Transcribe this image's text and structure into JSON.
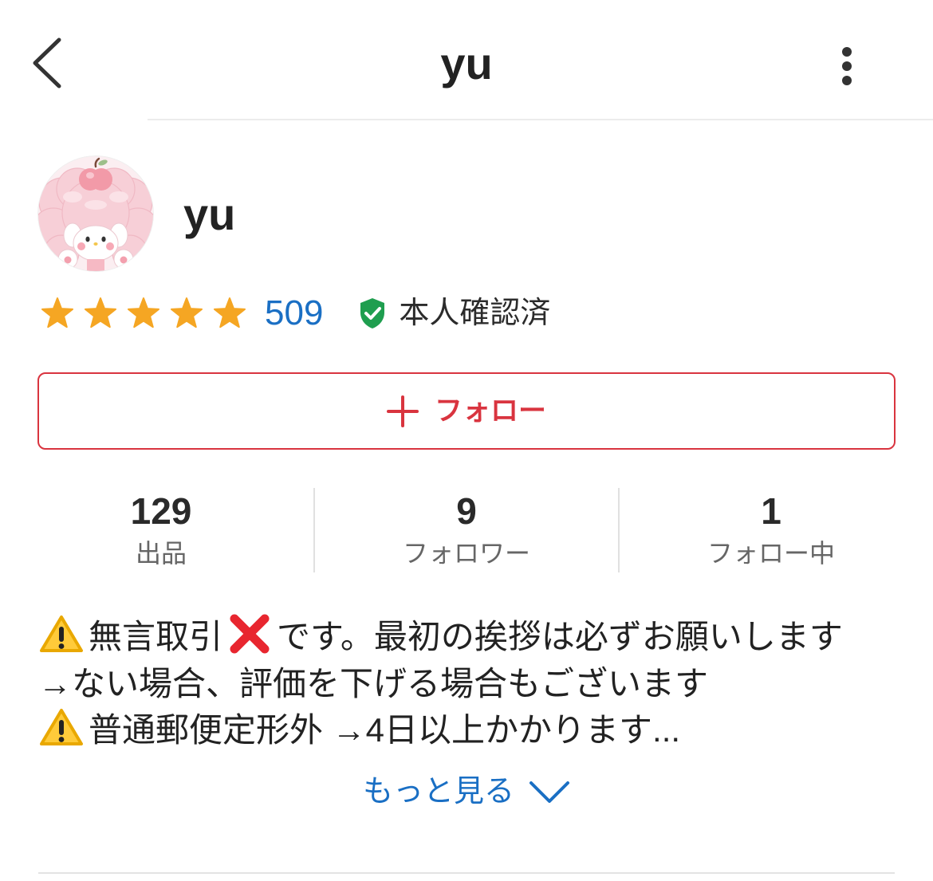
{
  "header": {
    "title": "yu",
    "back_icon": "chevron-left-icon",
    "menu_icon": "more-vertical-icon"
  },
  "profile": {
    "name": "yu",
    "rating": {
      "value": 5,
      "max": 5,
      "review_count": "509"
    },
    "verification": {
      "icon": "shield-check-icon",
      "label": "本人確認済"
    }
  },
  "follow_button": {
    "icon": "plus-icon",
    "label": "フォロー"
  },
  "stats": [
    {
      "value": "129",
      "label": "出品"
    },
    {
      "value": "9",
      "label": "フォロワー"
    },
    {
      "value": "1",
      "label": "フォロー中"
    }
  ],
  "bio": {
    "lines": [
      {
        "parts": [
          {
            "icon": "warning-icon"
          },
          {
            "text": "無言取引"
          },
          {
            "icon": "cross-mark-icon"
          },
          {
            "text": "です。最初の挨拶は必ずお願いします"
          }
        ]
      },
      {
        "parts": [
          {
            "text": "→ない場合、評価を下げる場合もございます"
          }
        ]
      },
      {
        "parts": [
          {
            "icon": "warning-icon"
          },
          {
            "text": "普通郵便定形外 →4日以上かかります..."
          }
        ]
      }
    ],
    "more_label": "もっと見る",
    "more_icon": "chevron-down-icon"
  },
  "colors": {
    "accent_red": "#d9343f",
    "link_blue": "#1a6fc4",
    "star": "#f5a623",
    "star_empty": "#dddddd",
    "verified_green": "#1f9e4f",
    "text": "#222222",
    "muted": "#666666"
  }
}
